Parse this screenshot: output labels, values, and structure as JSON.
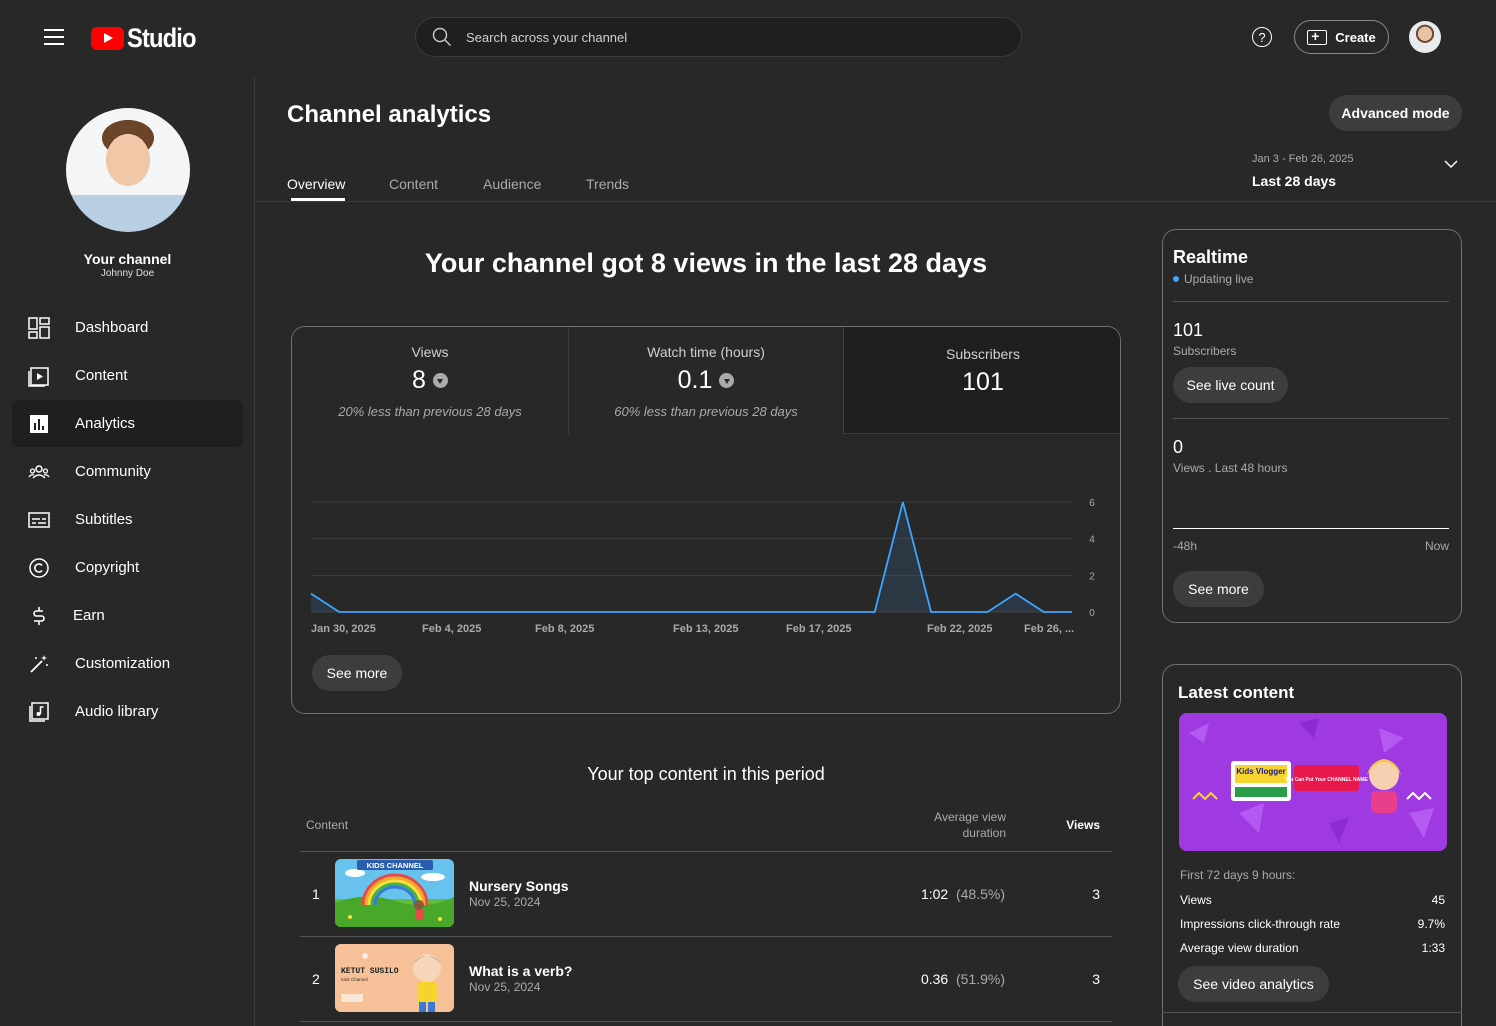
{
  "topbar": {
    "brand": "Studio",
    "search_placeholder": "Search across your channel",
    "create_label": "Create",
    "help": "?"
  },
  "sidebar": {
    "channel_title": "Your channel",
    "channel_name": "Johnny Doe",
    "items": [
      {
        "label": "Dashboard",
        "icon": "dashboard-icon"
      },
      {
        "label": "Content",
        "icon": "content-icon"
      },
      {
        "label": "Analytics",
        "icon": "analytics-icon",
        "active": true
      },
      {
        "label": "Community",
        "icon": "community-icon"
      },
      {
        "label": "Subtitles",
        "icon": "subtitles-icon"
      },
      {
        "label": "Copyright",
        "icon": "copyright-icon"
      },
      {
        "label": "Earn",
        "icon": "earn-icon"
      },
      {
        "label": "Customization",
        "icon": "customization-icon"
      },
      {
        "label": "Audio library",
        "icon": "audio-library-icon"
      }
    ]
  },
  "header": {
    "title": "Channel analytics",
    "advanced_mode": "Advanced mode",
    "tabs": [
      "Overview",
      "Content",
      "Audience",
      "Trends"
    ],
    "date_range": "Jan 3 - Feb 26, 2025",
    "date_label": "Last 28 days"
  },
  "overview": {
    "headline": "Your channel got 8 views in the last 28 days",
    "metrics": [
      {
        "label": "Views",
        "value": "8",
        "sub": "20% less than previous 28 days"
      },
      {
        "label": "Watch time (hours)",
        "value": "0.1",
        "sub": "60% less than previous 28 days"
      },
      {
        "label": "Subscribers",
        "value": "101"
      }
    ],
    "see_more": "See more"
  },
  "chart_data": {
    "type": "area",
    "x_tick_labels": [
      "Jan 30, 2025",
      "Feb 4, 2025",
      "Feb 8, 2025",
      "Feb 13, 2025",
      "Feb 17, 2025",
      "Feb 22, 2025",
      "Feb 26, ..."
    ],
    "y_ticks": [
      0,
      2,
      4,
      6
    ],
    "ylim": [
      0,
      6
    ],
    "values": [
      1,
      0,
      0,
      0,
      0,
      0,
      0,
      0,
      0,
      0,
      0,
      0,
      0,
      0,
      0,
      0,
      0,
      0,
      0,
      0,
      0,
      6,
      0,
      0,
      0,
      1,
      0,
      0
    ],
    "color": "#3ea6ff",
    "grid": true
  },
  "top_content": {
    "title": "Your top content in this period",
    "col_content": "Content",
    "col_avg": "Average view duration",
    "col_views": "Views",
    "rows": [
      {
        "rank": "1",
        "title": "Nursery Songs",
        "date": "Nov 25, 2024",
        "avd": "1:02",
        "pct": "(48.5%)",
        "views": "3",
        "thumb_text": "KIDS CHANNEL"
      },
      {
        "rank": "2",
        "title": "What is a verb?",
        "date": "Nov 25, 2024",
        "avd": "0.36",
        "pct": "(51.9%)",
        "views": "3",
        "thumb_text": "KETUT SUSILO",
        "thumb_sub": "Kids Channel"
      }
    ]
  },
  "realtime": {
    "title": "Realtime",
    "status": "Updating live",
    "subs_value": "101",
    "subs_label": "Subscribers",
    "live_count_btn": "See live count",
    "views_value": "0",
    "views_label": "Views . Last 48  hours",
    "axis_start": "-48h",
    "axis_end": "Now",
    "see_more": "See more"
  },
  "latest": {
    "title": "Latest content",
    "thumb_logo": "Kids Vlogger",
    "thumb_banner": "You Can Put Your CHANNEL NAME",
    "first_period": "First 72 days 9 hours:",
    "stats": [
      {
        "label": "Views",
        "value": "45"
      },
      {
        "label": "Impressions click-through rate",
        "value": "9.7%"
      },
      {
        "label": "Average view duration",
        "value": "1:33"
      }
    ],
    "button": "See video analytics"
  }
}
